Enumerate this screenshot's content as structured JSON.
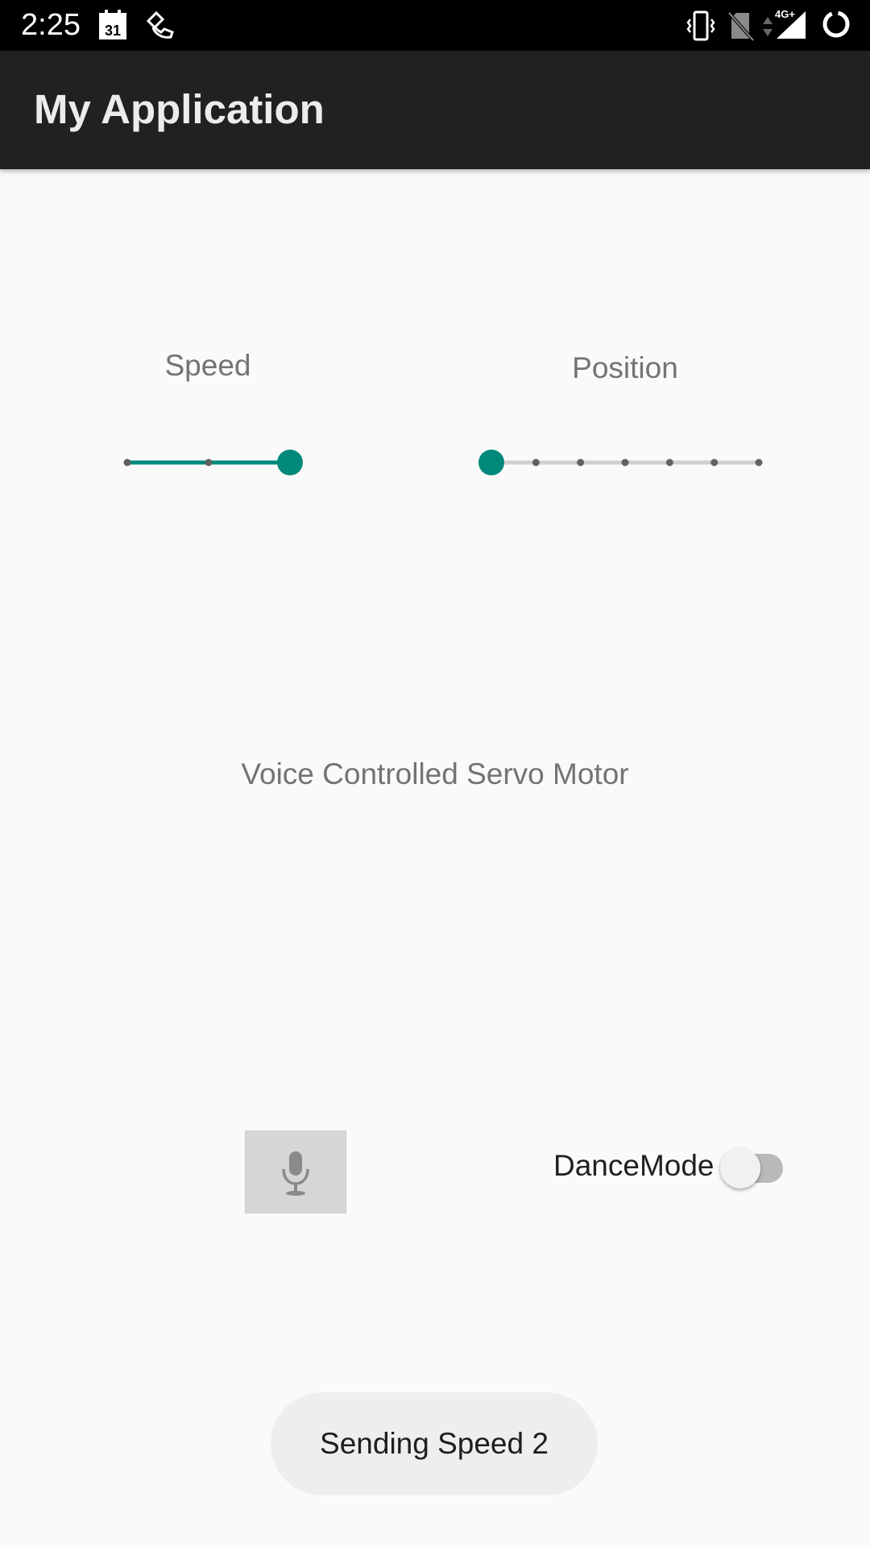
{
  "status_bar": {
    "time": "2:25",
    "icons": [
      "calendar-icon",
      "phone-hand-icon",
      "vibrate-icon",
      "no-sim-icon",
      "data-arrows-icon",
      "signal-4g-icon",
      "battery-ring-icon"
    ],
    "calendar_day": "31",
    "network": "4G+"
  },
  "app_bar": {
    "title": "My Application"
  },
  "speed": {
    "label": "Speed",
    "value": 2,
    "max": 2,
    "ticks": 3
  },
  "position": {
    "label": "Position",
    "value": 0,
    "max": 6,
    "ticks": 7
  },
  "main": {
    "title": "Voice Controlled Servo Motor"
  },
  "mic_button": {
    "icon": "microphone-icon"
  },
  "dance_mode": {
    "label": "DanceMode",
    "checked": false
  },
  "toast": {
    "text": "Sending Speed 2"
  },
  "colors": {
    "accent": "#00897b",
    "app_bar": "#212121",
    "background": "#fafafa"
  }
}
